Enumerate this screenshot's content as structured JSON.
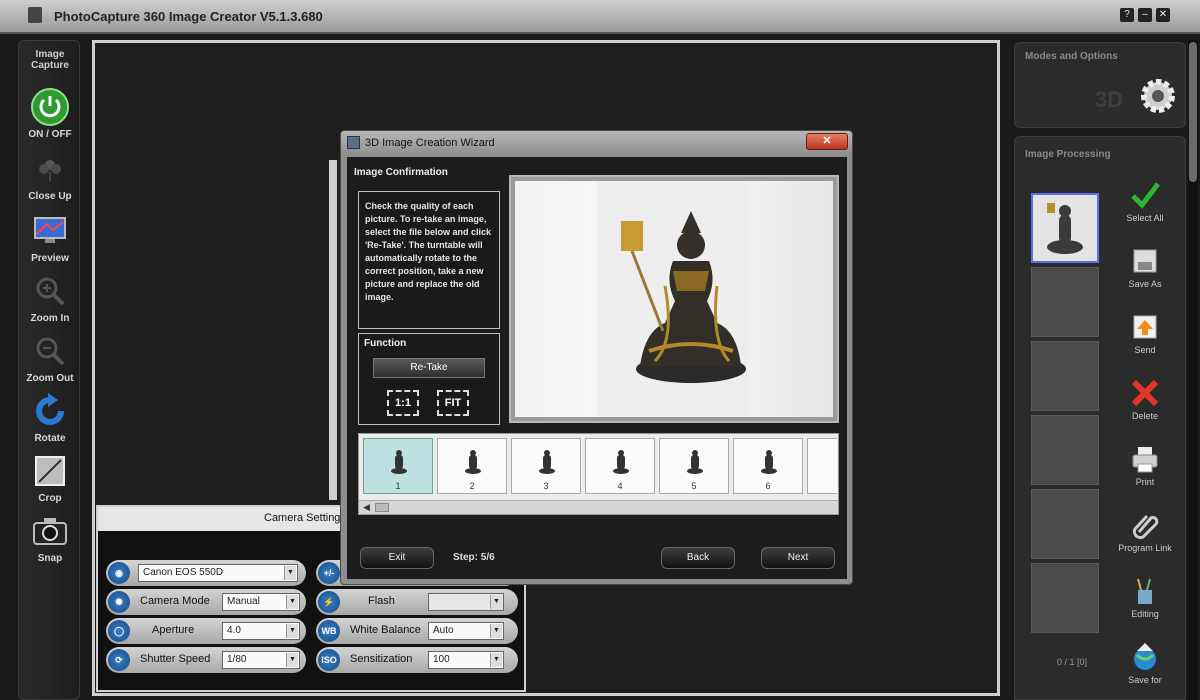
{
  "app": {
    "title": "PhotoCapture 360 Image Creator V5.1.3.680",
    "window_buttons": [
      "?",
      "–",
      "✕"
    ]
  },
  "left_toolbar": {
    "heading": "Image Capture",
    "items": [
      {
        "label": "ON / OFF",
        "icon": "power-icon"
      },
      {
        "label": "Close Up",
        "icon": "flower-icon"
      },
      {
        "label": "Preview",
        "icon": "monitor-icon"
      },
      {
        "label": "Zoom In",
        "icon": "zoom-in-icon"
      },
      {
        "label": "Zoom Out",
        "icon": "zoom-out-icon"
      },
      {
        "label": "Rotate",
        "icon": "rotate-icon"
      },
      {
        "label": "Crop",
        "icon": "crop-icon"
      },
      {
        "label": "Snap",
        "icon": "camera-icon"
      }
    ]
  },
  "right_panel": {
    "modes_heading": "Modes and Options",
    "mode_3d_label": "3D",
    "processing_heading": "Image Processing",
    "image_count": "0 / 1 [0]",
    "actions": [
      {
        "label": "Select All",
        "icon": "checkmark-icon"
      },
      {
        "label": "Save As",
        "icon": "save-icon"
      },
      {
        "label": "Send",
        "icon": "upload-icon"
      },
      {
        "label": "Delete",
        "icon": "delete-icon"
      },
      {
        "label": "Print",
        "icon": "printer-icon"
      },
      {
        "label": "Program Link",
        "icon": "paperclip-icon"
      },
      {
        "label": "Editing",
        "icon": "brush-icon"
      },
      {
        "label": "Save for",
        "icon": "globe-icon"
      }
    ]
  },
  "camera_settings": {
    "title": "Camera Setting",
    "camera_model": "Canon EOS 550D",
    "exposure_icon": "+/-",
    "camera_mode_label": "Camera Mode",
    "camera_mode_value": "Manual",
    "flash_label": "Flash",
    "flash_value": "",
    "aperture_label": "Aperture",
    "aperture_value": "4.0",
    "white_balance_icon": "WB",
    "white_balance_label": "White Balance",
    "white_balance_value": "Auto",
    "shutter_label": "Shutter Speed",
    "shutter_value": "1/80",
    "iso_icon": "ISO",
    "iso_label": "Sensitization",
    "iso_value": "100"
  },
  "wizard": {
    "title": "3D Image Creation Wizard",
    "close": "✕",
    "heading": "Image Confirmation",
    "instructions": "Check the quality of each picture. To re-take an image, select the file below and click 'Re-Take'. The turntable will automatically rotate to the correct position, take a new picture and replace the old image.",
    "function_heading": "Function",
    "retake_label": "Re-Take",
    "zoom_1to1": "1:1",
    "zoom_fit": "FIT",
    "thumbnails": [
      "1",
      "2",
      "3",
      "4",
      "5",
      "6"
    ],
    "exit_label": "Exit",
    "step_text": "Step: 5/6",
    "back_label": "Back",
    "next_label": "Next"
  }
}
